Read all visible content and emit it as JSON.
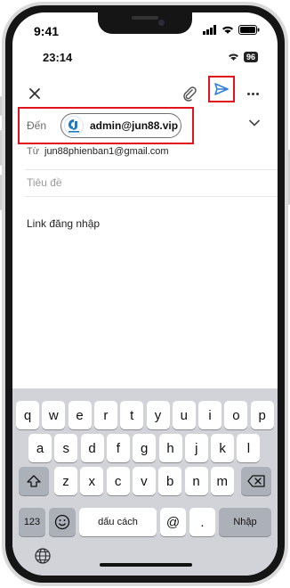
{
  "os_status": {
    "time": "9:41"
  },
  "app_status": {
    "time": "23:14",
    "battery": "96"
  },
  "toolbar": {
    "close_icon": "close-icon",
    "attach_icon": "paperclip-icon",
    "send_icon": "send-icon",
    "more_icon": "more-icon"
  },
  "compose": {
    "to_label": "Đến",
    "to_chip_email": "admin@jun88.vip",
    "from_label": "Từ",
    "from_value": "jun88phienban1@gmail.com",
    "subject_placeholder": "Tiêu đề",
    "body": "Link đăng nhập"
  },
  "keyboard": {
    "row1": [
      "q",
      "w",
      "e",
      "r",
      "t",
      "y",
      "u",
      "i",
      "o",
      "p"
    ],
    "row2": [
      "a",
      "s",
      "d",
      "f",
      "g",
      "h",
      "j",
      "k",
      "l"
    ],
    "row3": [
      "z",
      "x",
      "c",
      "v",
      "b",
      "n",
      "m"
    ],
    "numbers_key": "123",
    "space_key": "dấu cách",
    "at_key": "@",
    "dot_key": ".",
    "return_key": "Nhập"
  },
  "colors": {
    "highlight": "#e0141b",
    "send": "#2f7fd8",
    "keyboard_bg": "#d1d3d9"
  }
}
